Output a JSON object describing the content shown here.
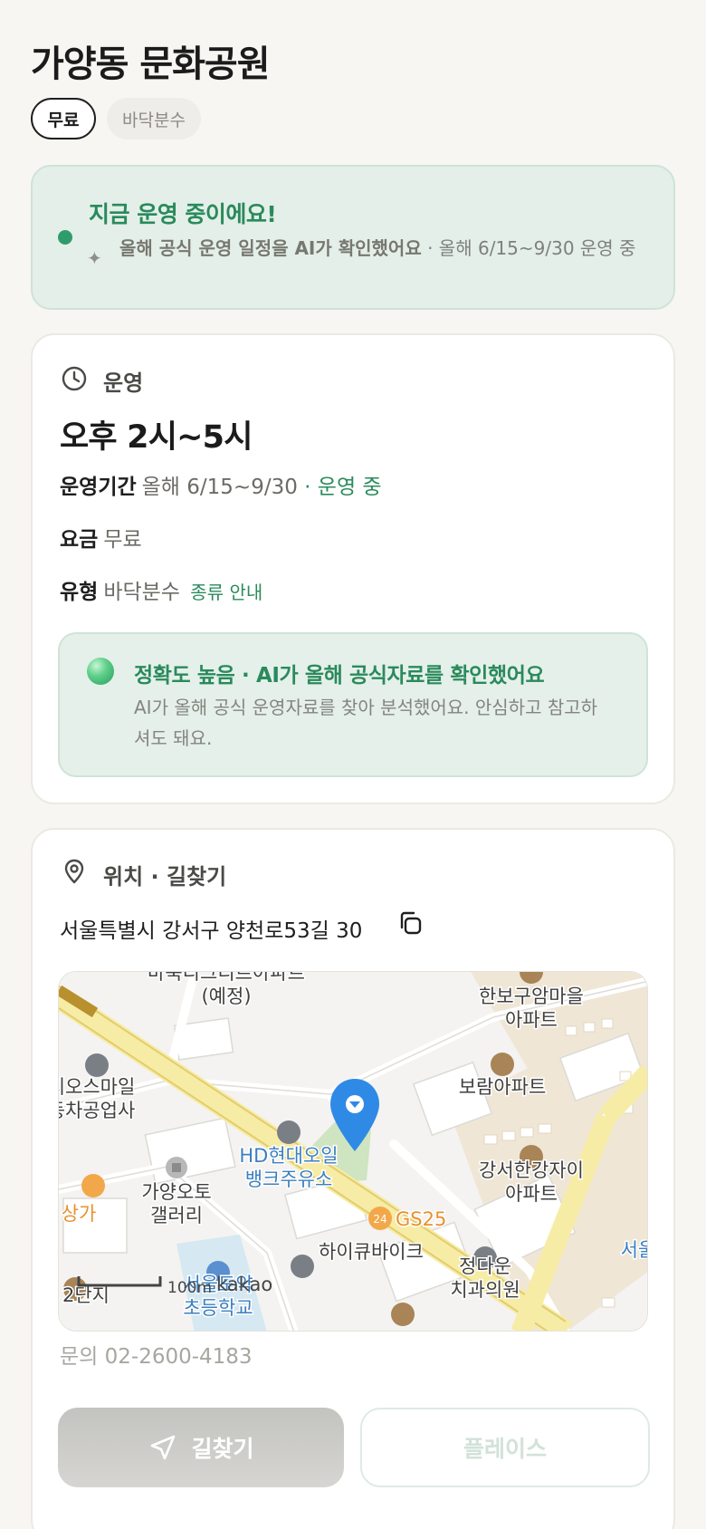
{
  "place": {
    "title": "가양동 문화공원",
    "tags": [
      "무료",
      "바닥분수"
    ]
  },
  "status": {
    "title": "지금 운영 중이에요!",
    "sub_bold": "올해 공식 운영 일정을 AI가 확인했어요",
    "sub_rest": " · 올해 6/15~9/30 운영 중",
    "icon": "sparkle-icon"
  },
  "operation": {
    "section_label": "운영",
    "hours": "오후 2시~5시",
    "period_key": "운영기간",
    "period_value": "올해 6/15~9/30",
    "period_status": "· 운영 중",
    "fee_key": "요금",
    "fee_value": "무료",
    "type_key": "유형",
    "type_value": "바닥분수",
    "type_link": "종류 안내",
    "accuracy_title": "정확도 높음 · AI가 올해 공식자료를 확인했어요",
    "accuracy_desc": "AI가 올해 공식 운영자료를 찾아 분석했어요. 안심하고 참고하셔도 돼요."
  },
  "location": {
    "section_label": "위치 · 길찾기",
    "address": "서울특별시 강서구 양천로53길 30",
    "contact": "문의 02-2600-4183",
    "route_button": "길찾기",
    "place_button": "플레이스"
  },
  "map": {
    "labels": {
      "apt_planned_top": "바욱디그디르아파트",
      "apt_planned": "(예정)",
      "hanbogu_1": "한보구암마을",
      "hanbogu_2": "아파트",
      "boram": "보람아파트",
      "jios_1": "지오스마일",
      "jios_2": "동차공업사",
      "hd_1": "HD현대오일",
      "hd_2": "뱅크주유소",
      "gangseo_1": "강서한강자이",
      "gangseo_2": "아파트",
      "gayang_1": "가양오토",
      "gayang_2": "갤러리",
      "sangga": "상가",
      "gs25": "GS25",
      "hicube": "하이큐바이크",
      "dental_1": "정다운",
      "dental_2": "치과의원",
      "seoul_right": "서울",
      "school_1": "서울도약",
      "school_2": "초등학교",
      "danji": "2단지",
      "scale": "100m",
      "brand": "kakao"
    }
  },
  "colors": {
    "accent_green": "#2a8a5c",
    "pin_blue": "#2f8ae6",
    "gs25_orange": "#e8912f",
    "road_yellow": "#f7eca6"
  }
}
